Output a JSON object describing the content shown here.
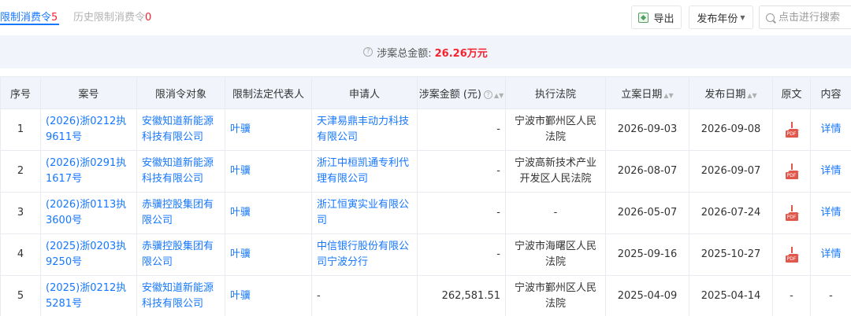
{
  "tabs": [
    {
      "label": "限制消费令",
      "count": "5"
    },
    {
      "label": "历史限制消费令",
      "count": "0"
    }
  ],
  "toolbar": {
    "export_label": "导出",
    "year_label": "发布年份",
    "search_placeholder": "点击进行搜索"
  },
  "summary": {
    "label": "涉案总金额:",
    "amount": "26.26万元"
  },
  "table": {
    "headers": {
      "index": "序号",
      "case_no": "案号",
      "target": "限消令对象",
      "legal_rep": "限制法定代表人",
      "applicant": "申请人",
      "amount": "涉案金额 (元)",
      "court": "执行法院",
      "filing_date": "立案日期",
      "publish_date": "发布日期",
      "original": "原文",
      "content": "内容"
    },
    "pdf_label": "PDF",
    "rows": [
      {
        "index": "1",
        "case_no": "(2026)浙0212执9611号",
        "target": "安徽知道新能源科技有限公司",
        "legal_rep": "叶骥",
        "applicant": "天津易鼎丰动力科技有限公司",
        "amount": "-",
        "court": "宁波市鄞州区人民法院",
        "filing_date": "2026-09-03",
        "publish_date": "2026-09-08",
        "has_pdf": true,
        "original_text": "",
        "content": "详情"
      },
      {
        "index": "2",
        "case_no": "(2026)浙0291执1617号",
        "target": "安徽知道新能源科技有限公司",
        "legal_rep": "叶骥",
        "applicant": "浙江中桓凯通专利代理有限公司",
        "amount": "-",
        "court": "宁波高新技术产业开发区人民法院",
        "filing_date": "2026-08-07",
        "publish_date": "2026-09-07",
        "has_pdf": true,
        "original_text": "",
        "content": "详情"
      },
      {
        "index": "3",
        "case_no": "(2026)浙0113执3600号",
        "target": "赤骥控股集团有限公司",
        "legal_rep": "叶骥",
        "applicant": "浙江恒寅实业有限公司",
        "amount": "-",
        "court": "-",
        "filing_date": "2026-05-07",
        "publish_date": "2026-07-24",
        "has_pdf": true,
        "original_text": "",
        "content": "详情"
      },
      {
        "index": "4",
        "case_no": "(2025)浙0203执9250号",
        "target": "赤骥控股集团有限公司",
        "legal_rep": "叶骥",
        "applicant": "中信银行股份有限公司宁波分行",
        "amount": "-",
        "court": "宁波市海曙区人民法院",
        "filing_date": "2025-09-16",
        "publish_date": "2025-10-27",
        "has_pdf": true,
        "original_text": "",
        "content": "详情"
      },
      {
        "index": "5",
        "case_no": "(2025)浙0212执5281号",
        "target": "安徽知道新能源科技有限公司",
        "legal_rep": "叶骥",
        "applicant": "-",
        "amount": "262,581.51",
        "court": "宁波市鄞州区人民法院",
        "filing_date": "2025-04-09",
        "publish_date": "2025-04-14",
        "has_pdf": false,
        "original_text": "-",
        "content": "-"
      }
    ]
  },
  "colors": {
    "accent": "#1677ff",
    "count_red": "#f5222d",
    "header_bg": "#f1f5fb",
    "pdf_red": "#e2574c"
  }
}
